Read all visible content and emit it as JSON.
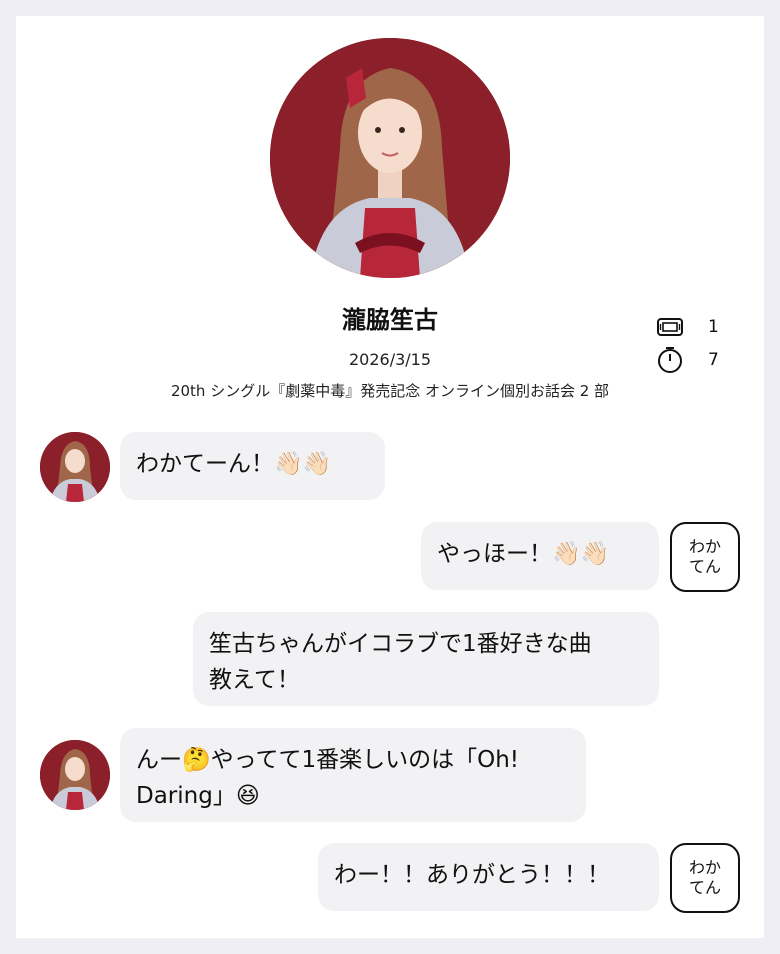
{
  "profile": {
    "name": "瀧脇笙古",
    "date": "2026/3/15",
    "event": "20th シングル『劇薬中毒』発売記念 オンライン個別お話会 2 部",
    "stats": [
      {
        "icon": "ticket-icon",
        "value": "1"
      },
      {
        "icon": "stopwatch-icon",
        "value": "7"
      }
    ]
  },
  "messages": [
    {
      "from": "idol",
      "text": "わかてーん！👋🏻👋🏻"
    },
    {
      "from": "user",
      "text": "やっほー！👋🏻👋🏻",
      "tag": "わか\nてん"
    },
    {
      "from": "user",
      "text": "笙古ちゃんがイコラブで1番好きな曲\n教えて！"
    },
    {
      "from": "idol",
      "text": "んー🤔やってて1番楽しいのは「Oh!\nDaring」😆"
    },
    {
      "from": "user",
      "text": "わー！！ありがとう！！！",
      "tag": "わか\nてん"
    }
  ],
  "colors": {
    "background": "#eeeef4",
    "card": "#ffffff",
    "bubble": "#f2f2f4",
    "photo_bg": "#8b1f2a"
  }
}
